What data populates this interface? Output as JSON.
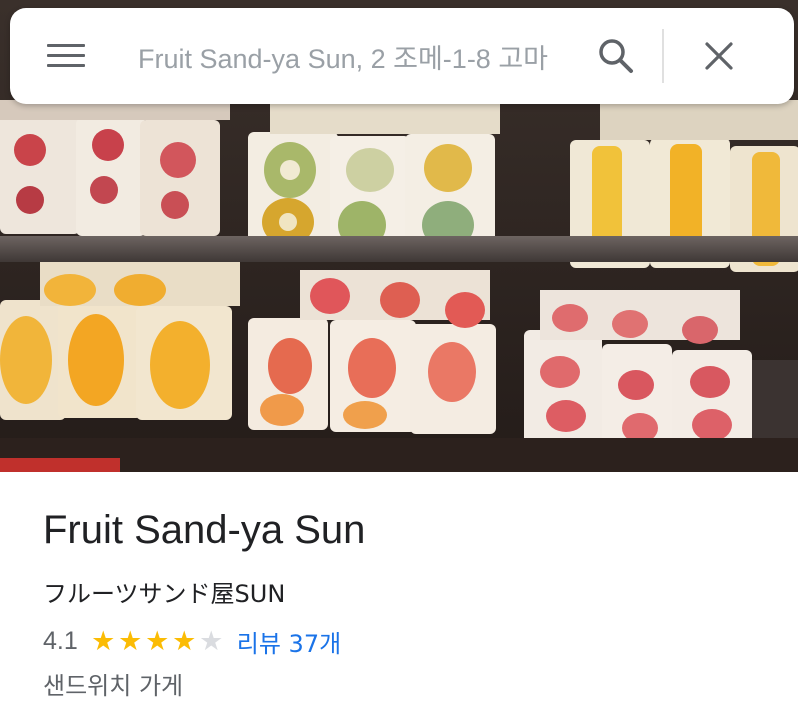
{
  "search": {
    "query": "Fruit Sand-ya Sun, 2 조메-1-8 고마",
    "menu_icon": "hamburger-menu-icon",
    "search_icon": "search-icon",
    "close_icon": "close-icon"
  },
  "place": {
    "name": "Fruit Sand-ya Sun",
    "native_name": "フルーツサンド屋SUN",
    "rating": "4.1",
    "stars_filled": 4,
    "stars_total": 5,
    "reviews_label": "리뷰 37개",
    "category": "샌드위치 가게"
  },
  "colors": {
    "star": "#fbbc04",
    "star_empty": "#dadce0",
    "link": "#1a73e8",
    "text_primary": "#202124",
    "text_secondary": "#5f6368"
  }
}
